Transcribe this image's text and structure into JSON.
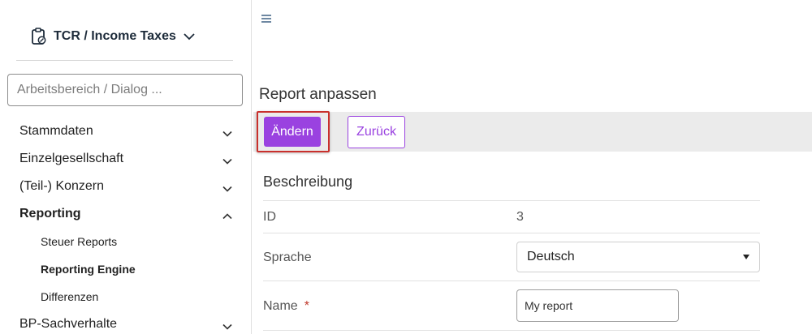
{
  "sidebar": {
    "workspace_title": "TCR / Income Taxes",
    "search_placeholder": "Arbeitsbereich / Dialog ...",
    "items": [
      {
        "label": "Stammdaten"
      },
      {
        "label": "Einzelgesellschaft"
      },
      {
        "label": "(Teil-) Konzern"
      },
      {
        "label": "Reporting",
        "expanded": true,
        "children": [
          {
            "label": "Steuer Reports"
          },
          {
            "label": "Reporting Engine",
            "active": true
          },
          {
            "label": "Differenzen"
          }
        ]
      },
      {
        "label": "BP-Sachverhalte"
      }
    ]
  },
  "main": {
    "title": "Report anpassen",
    "toolbar": {
      "primary_label": "Ändern",
      "secondary_label": "Zurück"
    },
    "section_title": "Beschreibung",
    "fields": {
      "id_label": "ID",
      "id_value": "3",
      "language_label": "Sprache",
      "language_value": "Deutsch",
      "name_label": "Name",
      "name_required_mark": "*",
      "name_value": "My report"
    }
  },
  "colors": {
    "accent": "#9a42e0",
    "focus_ring": "#c9302c",
    "toolbar_bg": "#ebebeb"
  }
}
